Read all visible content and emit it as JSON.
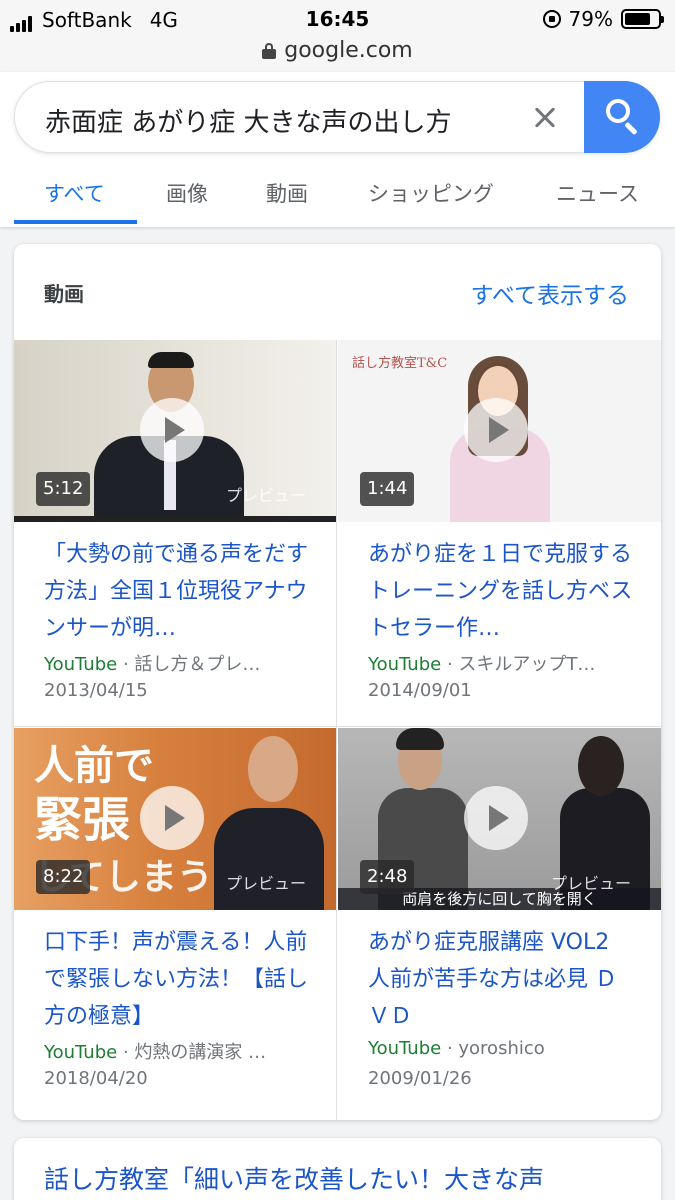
{
  "status_bar": {
    "carrier": "SoftBank",
    "network": "4G",
    "time": "16:45",
    "battery": "79%",
    "battery_level": 0.79
  },
  "url_bar": {
    "domain": "google.com"
  },
  "search": {
    "query": "赤面症 あがり症 大きな声の出し方"
  },
  "tabs": [
    {
      "label": "すべて",
      "active": true
    },
    {
      "label": "画像",
      "active": false
    },
    {
      "label": "動画",
      "active": false
    },
    {
      "label": "ショッピング",
      "active": false
    },
    {
      "label": "ニュース",
      "active": false
    }
  ],
  "videos_card": {
    "title": "動画",
    "see_all": "すべて表示する",
    "items": [
      {
        "duration": "5:12",
        "preview": "プレビュー",
        "title": "「大勢の前で通る声をだす方法」全国１位現役アナウンサーが明…",
        "source": "YouTube",
        "channel": "· 話し方＆プレ…",
        "date": "2013/04/15"
      },
      {
        "duration": "1:44",
        "thumb_label": "話し方教室T&C",
        "title": "あがり症を１日で克服するトレーニングを話し方ベストセラー作…",
        "source": "YouTube",
        "channel": "· スキルアップT…",
        "date": "2014/09/01"
      },
      {
        "duration": "8:22",
        "preview": "プレビュー",
        "thumb_text_1": "人前で",
        "thumb_text_2": "緊張",
        "thumb_text_3": "してしまう",
        "title": "口下手！声が震える！人前で緊張しない方法！【話し方の極意】",
        "source": "YouTube",
        "channel": "· 灼熱の講演家 …",
        "date": "2018/04/20"
      },
      {
        "duration": "2:48",
        "preview": "プレビュー",
        "thumb_caption": "両肩を後方に回して胸を開く",
        "title": "あがり症克服講座 VOL2 人前が苦手な方は必見 ＤＶＤ",
        "source": "YouTube",
        "channel": "· yoroshico",
        "date": "2009/01/26"
      }
    ]
  },
  "next_result": {
    "title": "話し方教室「細い声を改善したい！大きな声"
  },
  "colors": {
    "accent_blue": "#4285f4",
    "link_blue": "#1a55c9",
    "tab_active": "#1a73e8",
    "source_green": "#1e7e34"
  }
}
